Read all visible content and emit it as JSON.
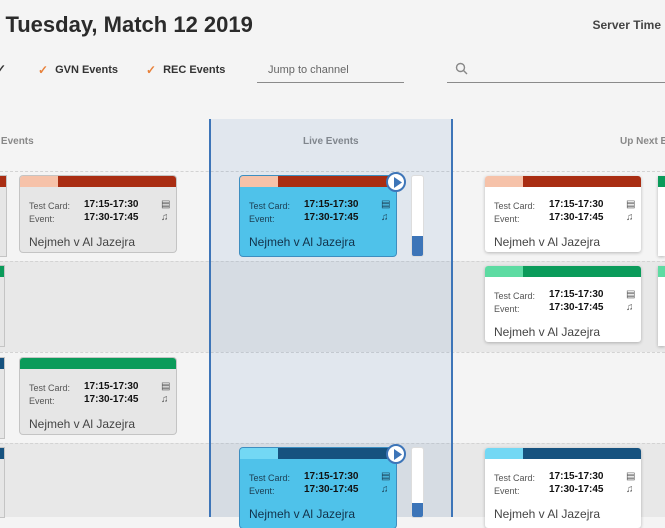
{
  "header": {
    "title": "- Tuesday, Match 12 2019",
    "server_time_label": "Server Time"
  },
  "filters": [
    {
      "label": "GVN Events",
      "checked": true
    },
    {
      "label": "REC Events",
      "checked": true
    }
  ],
  "jump": {
    "placeholder": "Jump to channel"
  },
  "columns": {
    "past": "Past Events",
    "live": "Live Events",
    "upnext": "Up Next Events"
  },
  "colors": {
    "red": "#a92d12",
    "red_light": "#f6c2a9",
    "green": "#0a9b5a",
    "green_light": "#5ddba2",
    "blue": "#16527f",
    "blue_light": "#73d8f4",
    "accent": "#3d75b8",
    "check": "#e8813a"
  },
  "card_labels": {
    "test_card": "Test Card:",
    "event": "Event:"
  },
  "cards": {
    "past_1": {
      "test_card_time": "17:15-17:30",
      "event_time": "17:30-17:45",
      "name": "Nejmeh v Al Jazejra"
    },
    "past_3": {
      "test_card_time": "17:15-17:30",
      "event_time": "17:30-17:45",
      "name": "Nejmeh v Al Jazejra"
    },
    "live_1": {
      "test_card_time": "17:15-17:30",
      "event_time": "17:30-17:45",
      "name": "Nejmeh v Al Jazejra",
      "progress": 0.25
    },
    "live_4": {
      "test_card_time": "17:15-17:30",
      "event_time": "17:30-17:45",
      "name": "Nejmeh v Al Jazejra",
      "progress": 0.2
    },
    "next_1": {
      "test_card_time": "17:15-17:30",
      "event_time": "17:30-17:45",
      "name": "Nejmeh v Al Jazejra"
    },
    "next_2": {
      "test_card_time": "17:15-17:30",
      "event_time": "17:30-17:45",
      "name": "Nejmeh v Al Jazejra"
    },
    "next_4": {
      "test_card_time": "17:15-17:30",
      "event_time": "17:30-17:45",
      "name": "Nejmeh v Al Jazejra"
    }
  }
}
